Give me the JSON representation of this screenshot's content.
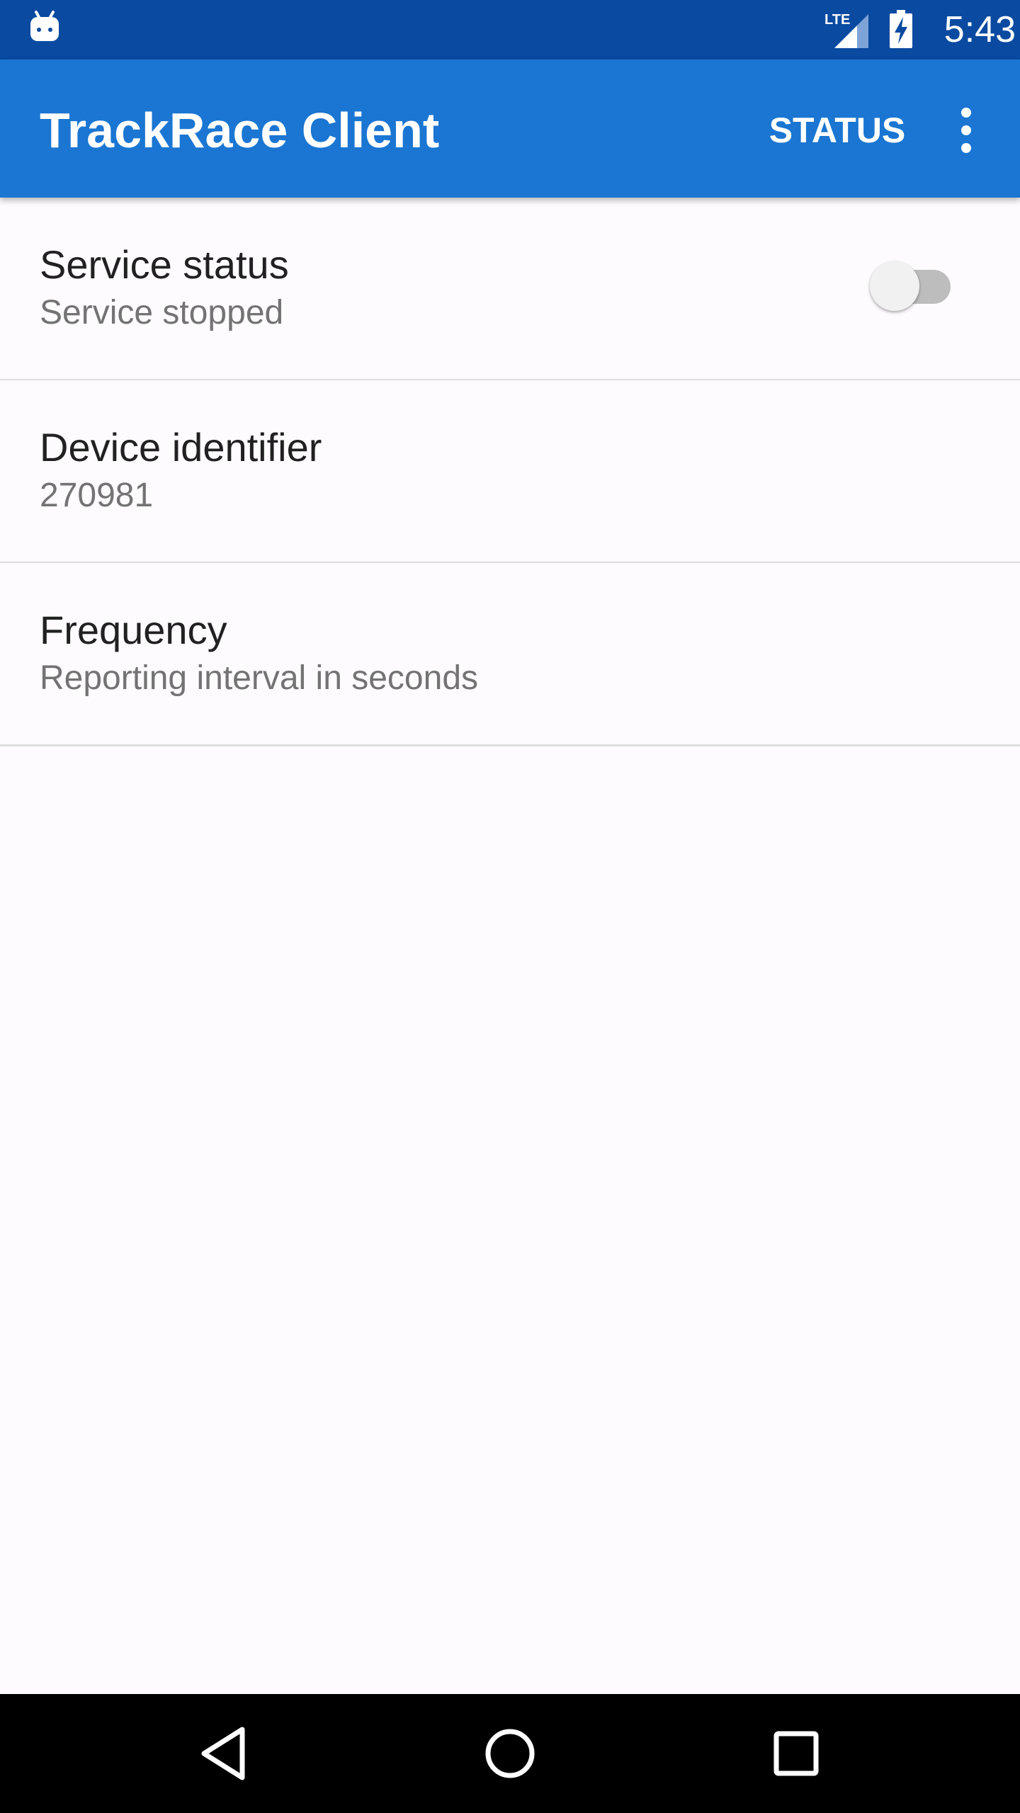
{
  "status_bar": {
    "time": "5:43",
    "icons": [
      "android-notification-icon",
      "lte-signal-icon",
      "battery-charging-icon"
    ]
  },
  "app_bar": {
    "title": "TrackRace Client",
    "status_action": "STATUS",
    "overflow_icon": "more-vert-icon"
  },
  "preferences": [
    {
      "title": "Service status",
      "summary": "Service stopped",
      "switch_on": false
    },
    {
      "title": "Device identifier",
      "summary": "270981"
    },
    {
      "title": "Frequency",
      "summary": "Reporting interval in seconds"
    }
  ],
  "nav_bar": {
    "icons": [
      "back-icon",
      "home-icon",
      "recents-icon"
    ]
  },
  "colors": {
    "status_bar": "#0a4aa1",
    "app_bar": "#1a76d2",
    "background": "#fdfbfd",
    "divider": "#dddddd",
    "title_text": "#212121",
    "summary_text": "#737373",
    "switch_track_off": "#bdbdbd",
    "switch_thumb_off": "#f1f1f1"
  }
}
